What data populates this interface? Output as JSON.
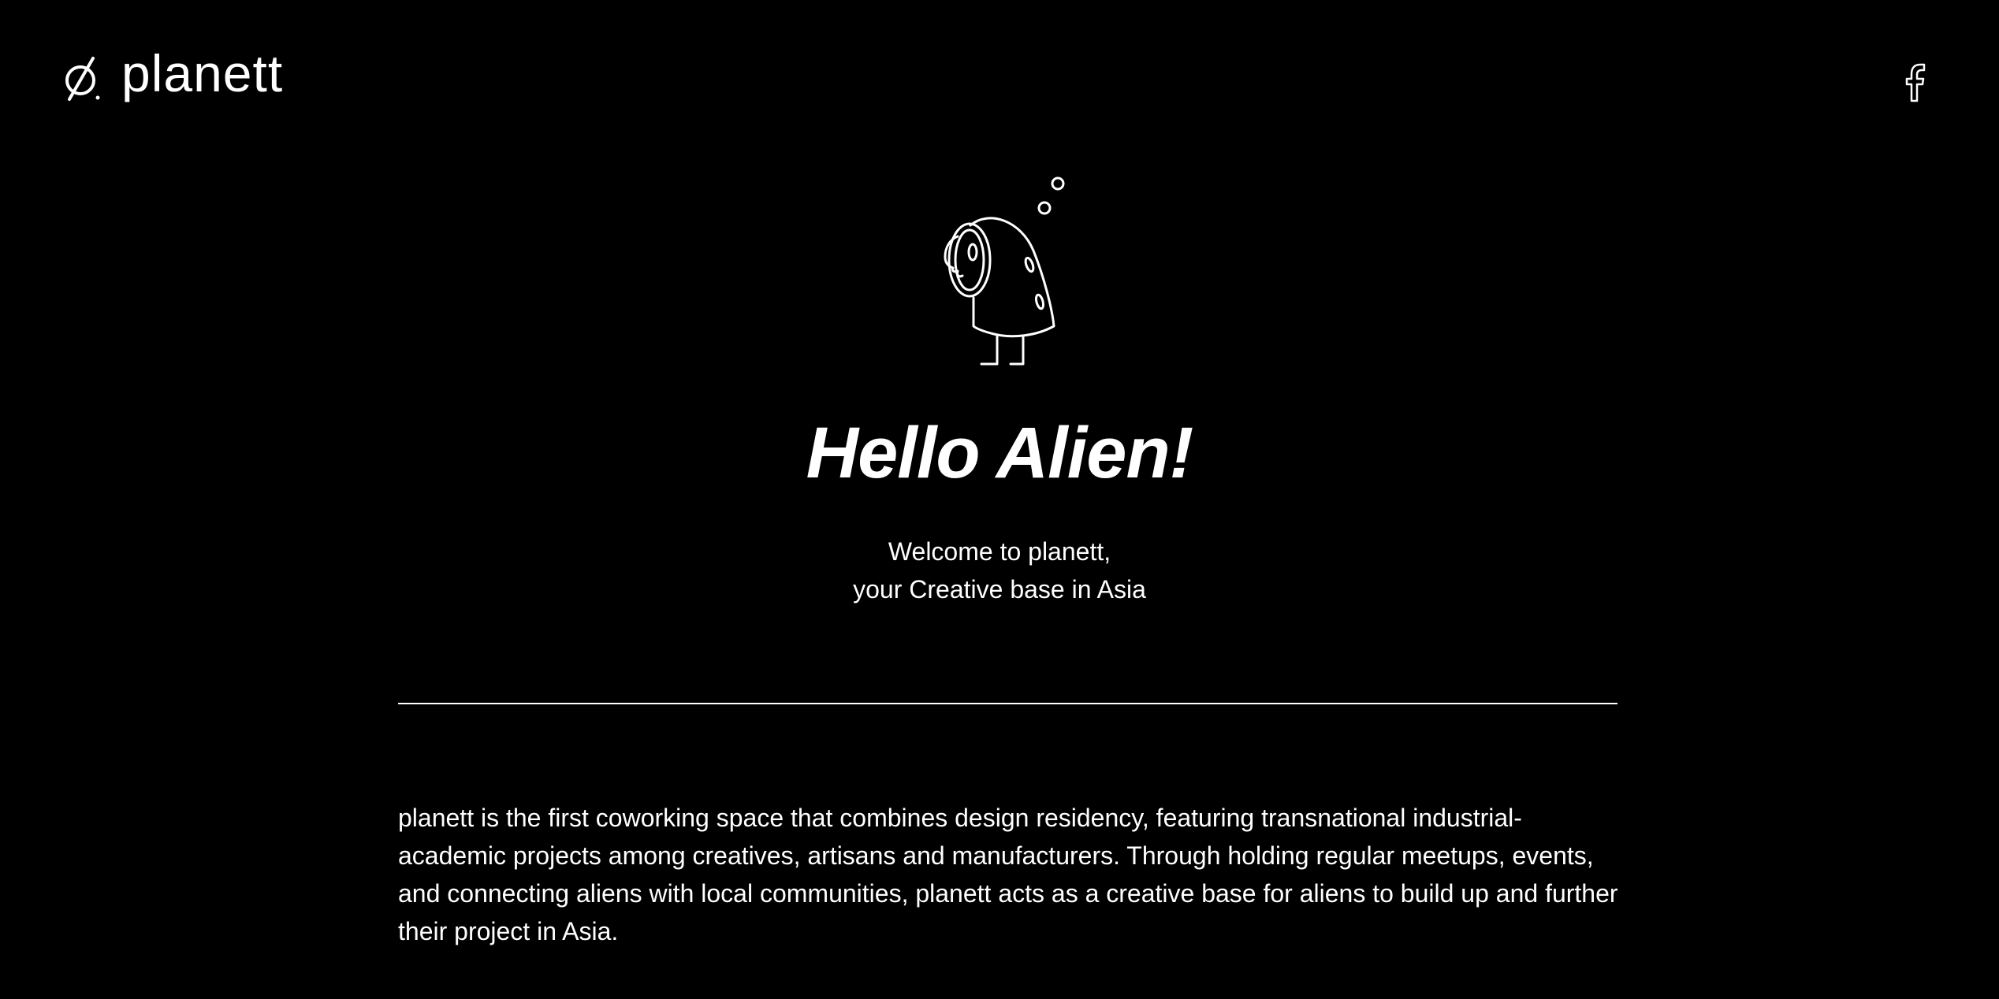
{
  "header": {
    "logo_icon": "planett-logo-mark",
    "logo_text": "planett",
    "social_icon": "facebook-icon"
  },
  "hero": {
    "illustration": "alien-illustration",
    "title": "Hello Alien!",
    "subtitle_line1": "Welcome to planett,",
    "subtitle_line2": "your Creative base in Asia"
  },
  "about": {
    "text": "planett is the first coworking space that combines design residency, featuring transnational industrial-academic projects among creatives, artisans and manufacturers. Through holding regular meetups, events, and connecting aliens with local communities, planett acts as a creative base for aliens to build up and further their project in Asia."
  },
  "colors": {
    "background": "#000000",
    "foreground": "#ffffff"
  }
}
